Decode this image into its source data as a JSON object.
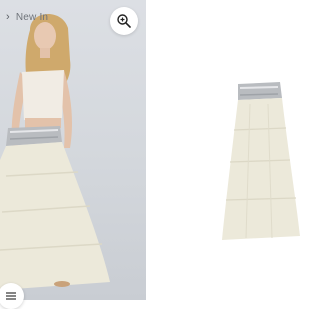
{
  "breadcrumb": {
    "label": "New In"
  },
  "icons": {
    "back": "chevron-left-icon",
    "zoom": "zoom-in-icon",
    "menu": "menu-lines-icon"
  },
  "colors": {
    "photo_background": "#d5d9de",
    "skirt": "#ece9da",
    "sequin_waistband": "#b9bcc0",
    "page_background": "#ffffff"
  }
}
